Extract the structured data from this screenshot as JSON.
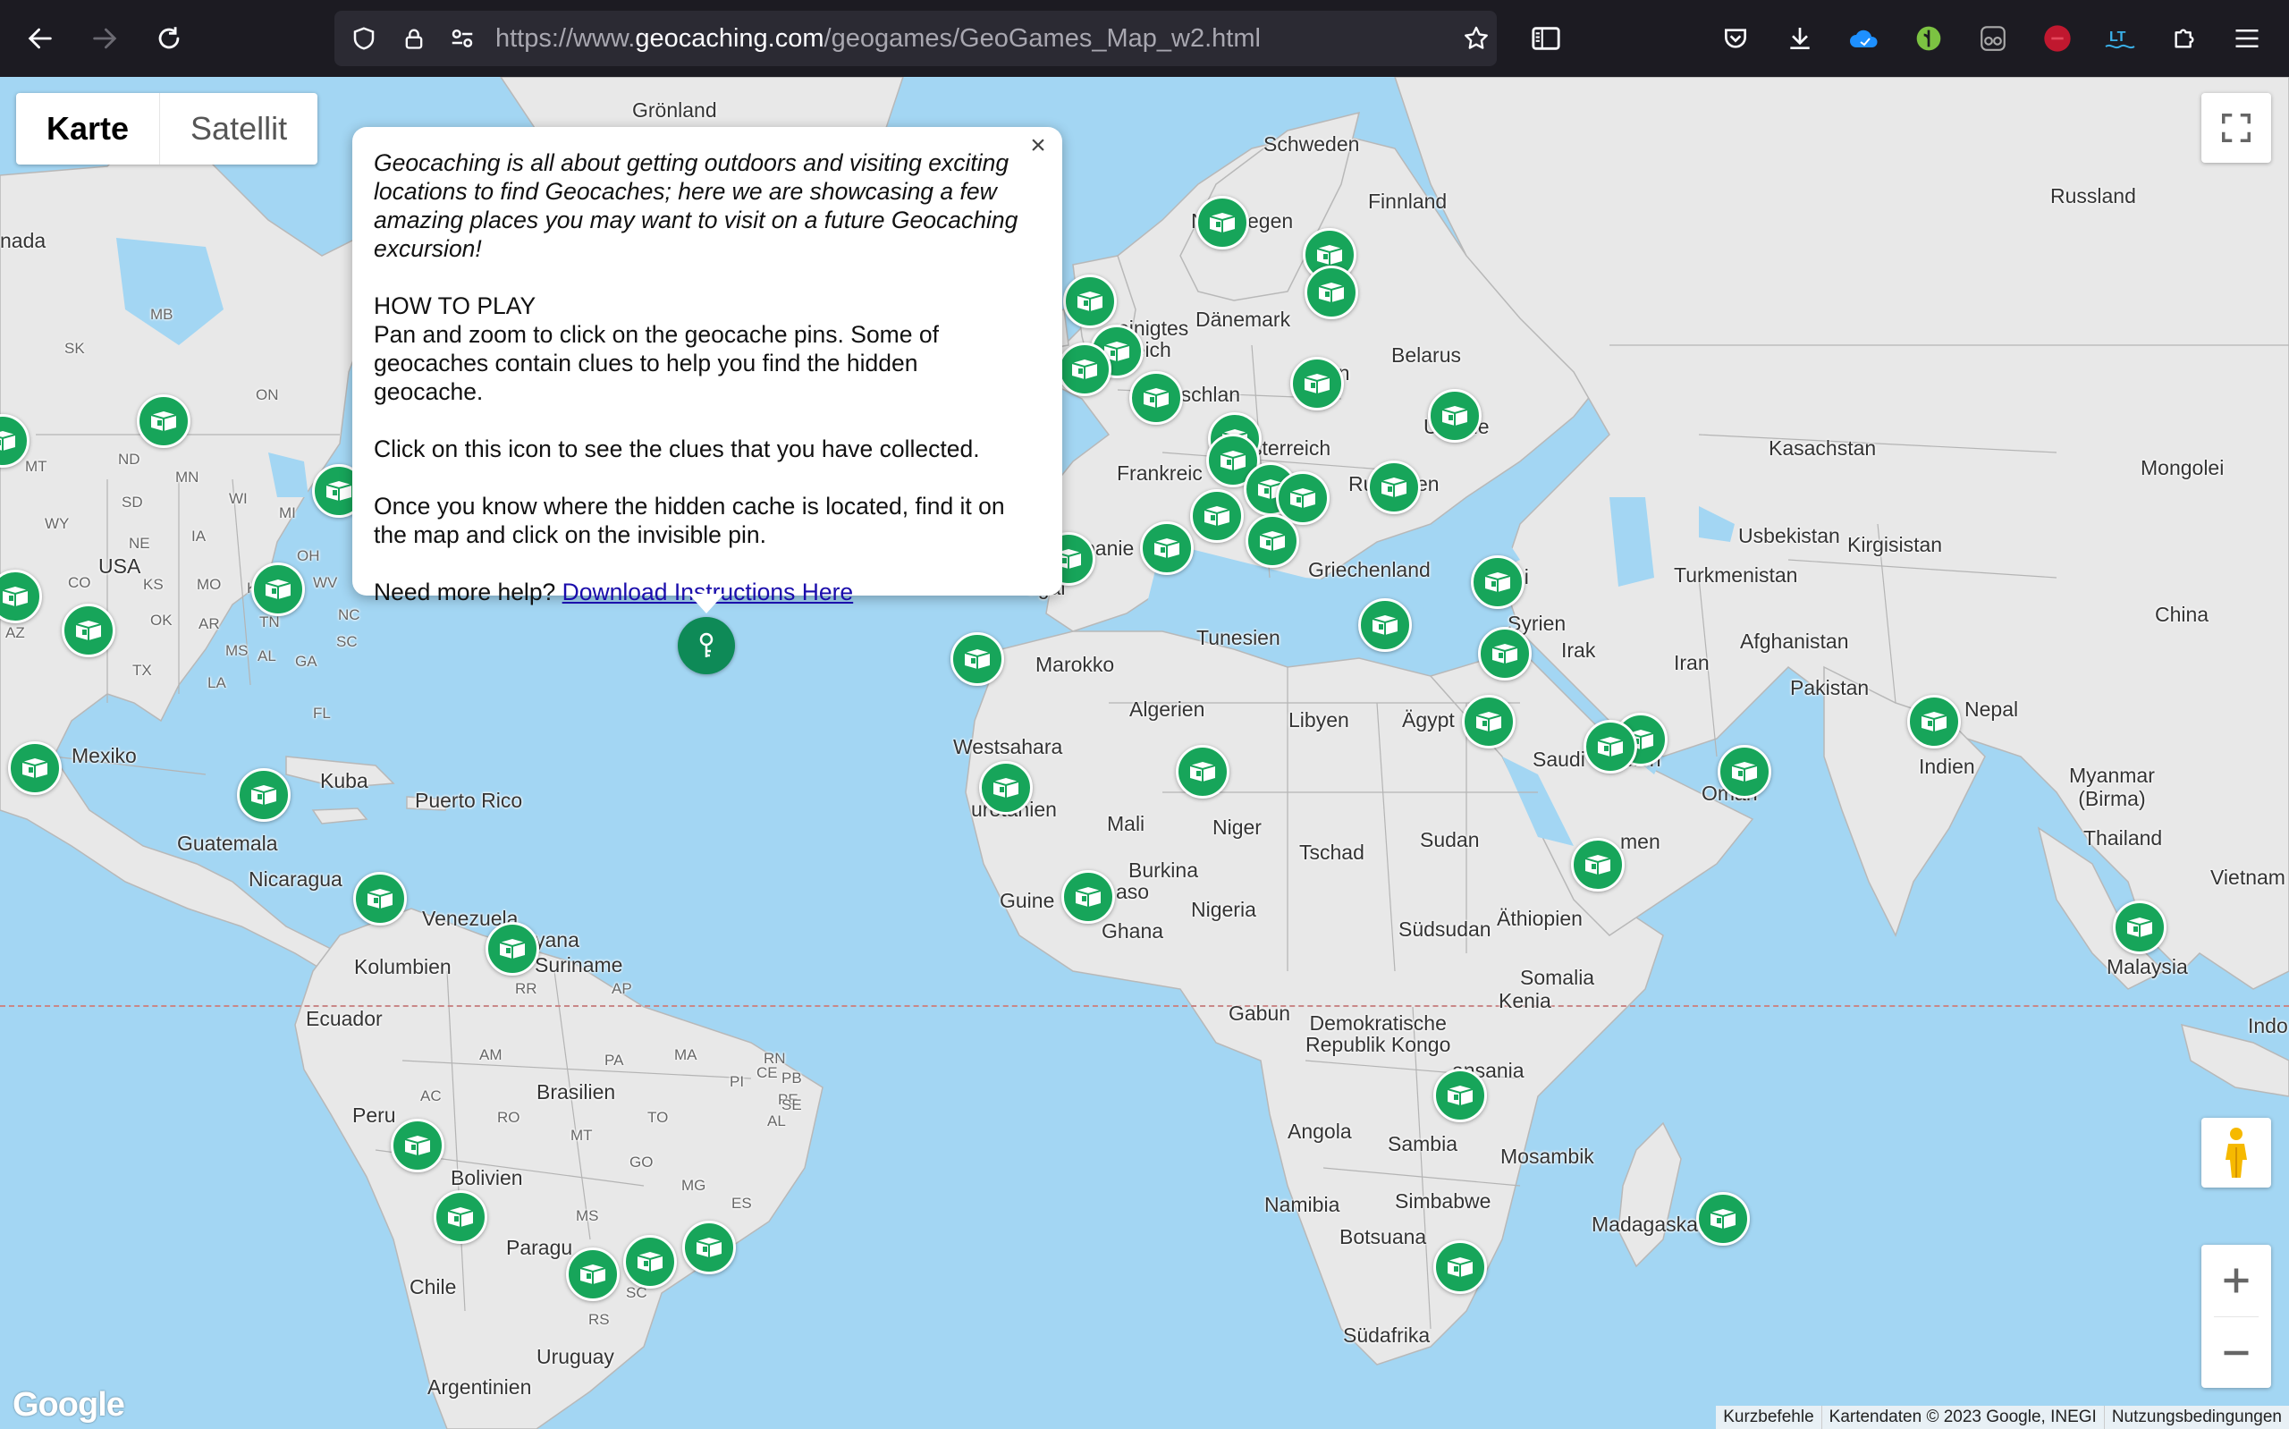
{
  "browser": {
    "url_prefix": "https://www.",
    "url_host": "geocaching.com",
    "url_path": "/geogames/GeoGames_Map_w2.html"
  },
  "map_type": {
    "map_label": "Karte",
    "satellite_label": "Satellit"
  },
  "info_window": {
    "intro": "Geocaching is all about getting outdoors and visiting exciting locations to find Geocaches; here we are showcasing a few amazing places you may want to visit on a future Geocaching excursion!",
    "how_title": "HOW TO PLAY",
    "how_text": "Pan and zoom to click on the geocache pins. Some of geocaches contain clues to help you find the hidden geocache.",
    "clues_text": "Click on this icon to see the clues that you have collected.",
    "hidden_text": "Once you know where the hidden cache is located, find it on the map and click on the invisible pin.",
    "help_prefix": "Need more help? ",
    "help_link": "Download Instructions Here",
    "close_glyph": "×"
  },
  "labels": {
    "groenland": "Grönland",
    "schweden": "Schweden",
    "finnland": "Finnland",
    "russland": "Russland",
    "nada": "nada",
    "norwegen_a": "N",
    "norwegen_b": "egen",
    "vereinigtes": "einigtes",
    "reich": "reich",
    "daenemark": "Dänemark",
    "belarus": "Belarus",
    "deutschland": "Deutschlan",
    "polen_tail": "en",
    "ukraine_a": "U",
    "ukraine_b": "ne",
    "oesterreich": "sterreich",
    "frankreich": "Frankreic",
    "rumaenien_a": "Ru",
    "rumaenien_b": "en",
    "kasachstan": "Kasachstan",
    "mongolei": "Mongolei",
    "spanien": "panie",
    "portugal": "ugal",
    "griechenland": "Griechenland",
    "tuerkei": "ei",
    "usbekistan": "Usbekistan",
    "kirgisistan": "Kirgisistan",
    "turkmenistan": "Turkmenistan",
    "china": "China",
    "syrien": "Syrien",
    "irak": "Irak",
    "iran": "Iran",
    "afghanistan": "Afghanistan",
    "tunesien": "Tunesien",
    "marokko": "Marokko",
    "pakistan": "Pakistan",
    "nepal": "Nepal",
    "algerien": "Algerien",
    "libyen": "Libyen",
    "aegypten": "Ägypt",
    "saudi_a": "Saudi",
    "saudi_b": "bien",
    "oman": "Oman",
    "indien": "Indien",
    "westsahara": "Westsahara",
    "mauretanien": "uretanien",
    "mali": "Mali",
    "niger": "Niger",
    "tschad": "Tschad",
    "sudan": "Sudan",
    "jemen": "men",
    "myanmar": "Myanmar\n(Birma)",
    "thailand": "Thailand",
    "vietnam": "Vietnam",
    "burkina": "Burkina",
    "faso": "aso",
    "guinea": "Guine",
    "ghana": "Ghana",
    "nigeria": "Nigeria",
    "suedsudan": "Südsudan",
    "aethiopien": "Äthiopien",
    "somalia": "Somalia",
    "malaysia": "Malaysia",
    "gabun": "Gabun",
    "kongo": "Demokratische\nRepublik Kongo",
    "kenia": "Kenia",
    "tansania": "ansania",
    "angola": "Angola",
    "sambia": "Sambia",
    "mosambik": "Mosambik",
    "namibia": "Namibia",
    "simbabwe": "Simbabwe",
    "madagaskar": "Madagaskar",
    "botsuana": "Botsuana",
    "suedafrika": "Südafrika",
    "indo": "Indo",
    "usa": "USA",
    "mexiko": "Mexiko",
    "kuba": "Kuba",
    "puerto_rico": "Puerto Rico",
    "guatemala": "Guatemala",
    "nicaragua": "Nicaragua",
    "venezuela": "Venezuela",
    "guyana": "yana",
    "suriname": "Suriname",
    "kolumbien": "Kolumbien",
    "ecuador": "Ecuador",
    "brasilien": "Brasilien",
    "peru": "Peru",
    "bolivien": "Bolivien",
    "paraguay": "Paragu",
    "chile": "Chile",
    "uruguay": "Uruguay",
    "argentinien": "Argentinien",
    "states": [
      "MB",
      "SK",
      "ON",
      "MT",
      "ND",
      "MN",
      "SD",
      "WY",
      "WI",
      "MI",
      "NE",
      "IA",
      "OH",
      "CO",
      "KS",
      "MO",
      "KY",
      "WV",
      "AZ",
      "OK",
      "AR",
      "TN",
      "NC",
      "SC",
      "MS",
      "AL",
      "GA",
      "TX",
      "LA",
      "FL",
      "AM",
      "PA",
      "MA",
      "RN",
      "AC",
      "RO",
      "TO",
      "PE",
      "MT",
      "PB",
      "AL",
      "SE",
      "GO",
      "MG",
      "MS",
      "ES",
      "SC",
      "RS",
      "AP",
      "RR",
      "PI",
      "CE"
    ]
  },
  "footer": {
    "logo": "Google",
    "shortcuts": "Kurzbefehle",
    "mapdata": "Kartendaten © 2023 Google, INEGI",
    "terms": "Nutzungsbedingungen"
  },
  "icons": {
    "back": "back-arrow-icon",
    "forward": "forward-arrow-icon",
    "reload": "reload-icon",
    "pin": "geocache-icon"
  }
}
